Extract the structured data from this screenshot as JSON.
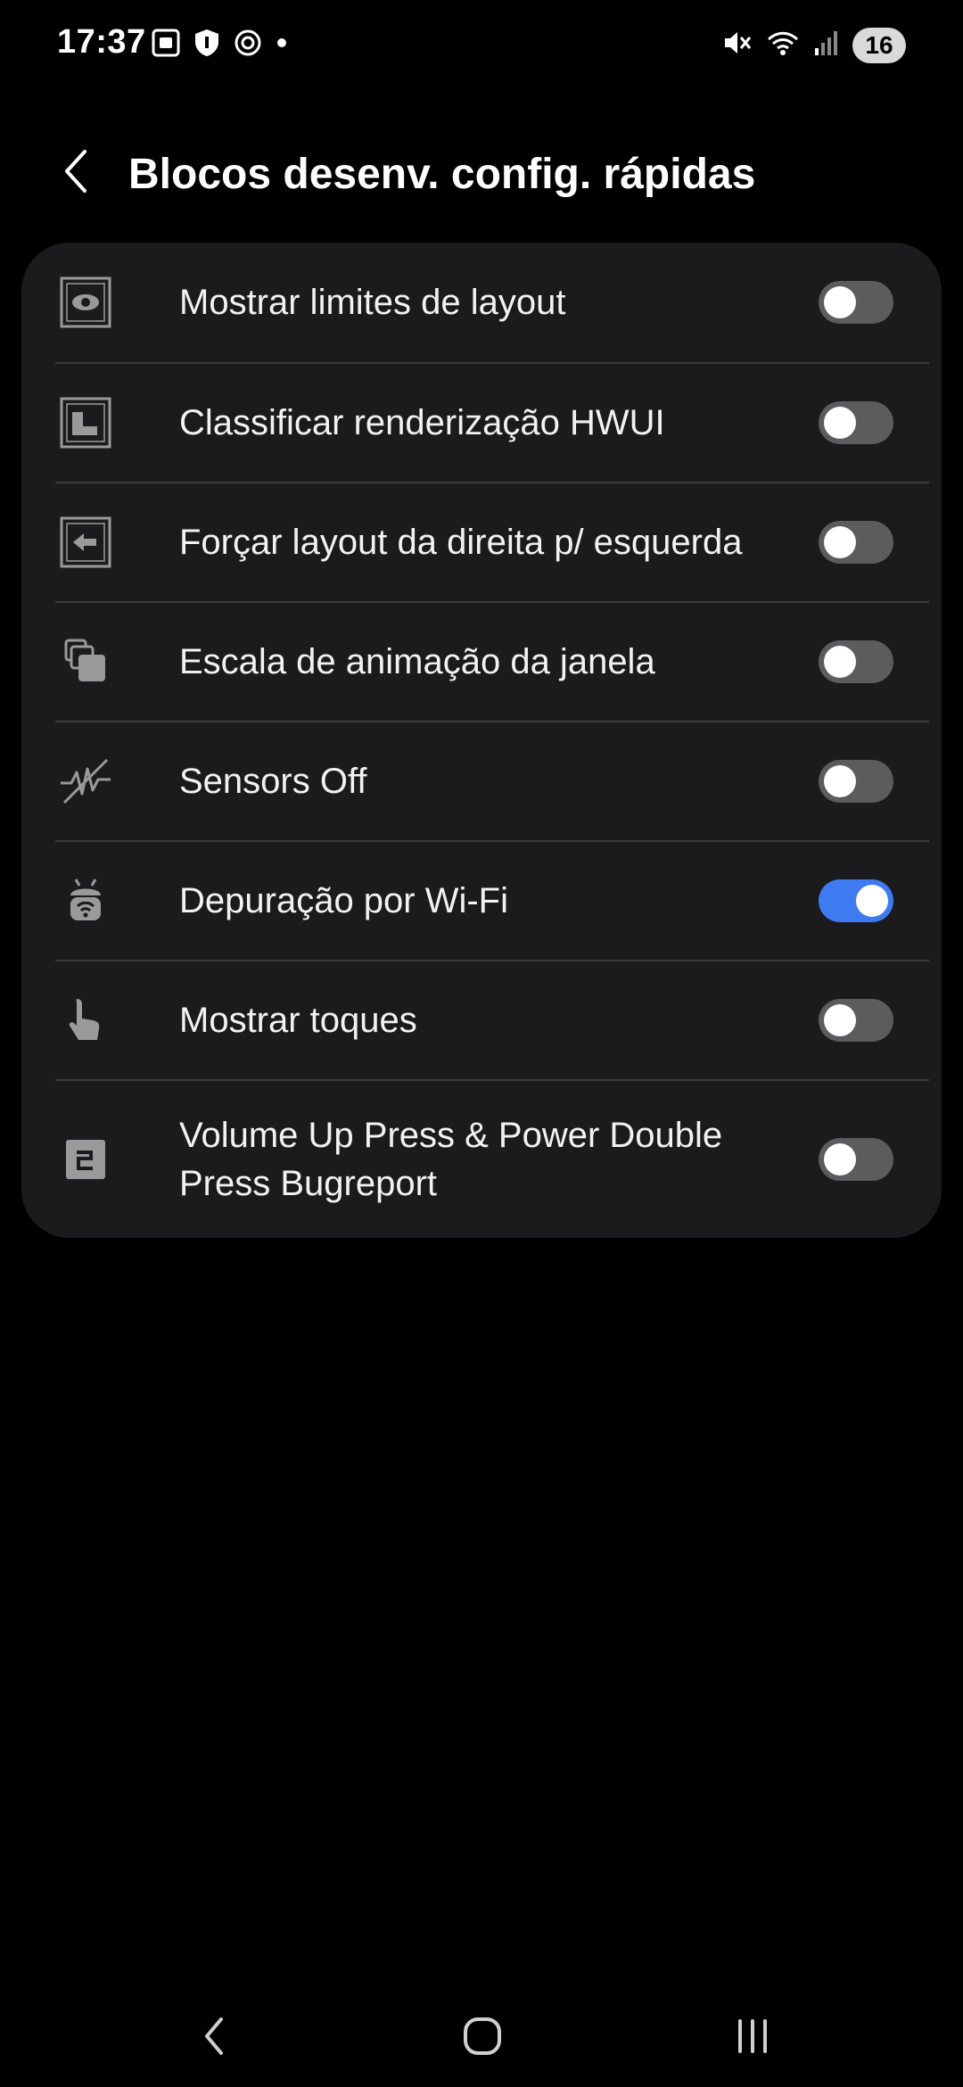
{
  "status_bar": {
    "time": "17:37",
    "battery_level": "16",
    "left_icons": [
      "screenshot-icon",
      "shield-icon",
      "threads-icon",
      "dot-icon"
    ],
    "right_icons": [
      "mute-icon",
      "wifi-icon",
      "signal-icon"
    ]
  },
  "header": {
    "title": "Blocos desenv. config. rápidas",
    "back_icon": "chevron-left-icon"
  },
  "tiles": [
    {
      "label": "Mostrar limites de layout",
      "icon": "layout-bounds-icon",
      "enabled": false
    },
    {
      "label": "Classificar renderização HWUI",
      "icon": "hwui-render-icon",
      "enabled": false
    },
    {
      "label": "Forçar layout da direita p/ esquerda",
      "icon": "rtl-layout-icon",
      "enabled": false
    },
    {
      "label": "Escala de animação da janela",
      "icon": "animation-scale-icon",
      "enabled": false
    },
    {
      "label": "Sensors Off",
      "icon": "sensors-off-icon",
      "enabled": false
    },
    {
      "label": "Depuração por Wi-Fi",
      "icon": "wifi-debug-icon",
      "enabled": true
    },
    {
      "label": "Mostrar toques",
      "icon": "touch-icon",
      "enabled": false
    },
    {
      "label": "Volume Up Press & Power Double Press Bugreport",
      "icon": "bugreport-icon",
      "enabled": false
    }
  ],
  "nav_bar": {
    "back_icon": "nav-back-icon",
    "home_icon": "nav-home-icon",
    "recents_icon": "nav-recents-icon"
  },
  "colors": {
    "background": "#000000",
    "card": "#1b1b1d",
    "toggle_on": "#3e7bf1",
    "toggle_off": "#5c5c5f",
    "divider": "#3a3a3c"
  }
}
